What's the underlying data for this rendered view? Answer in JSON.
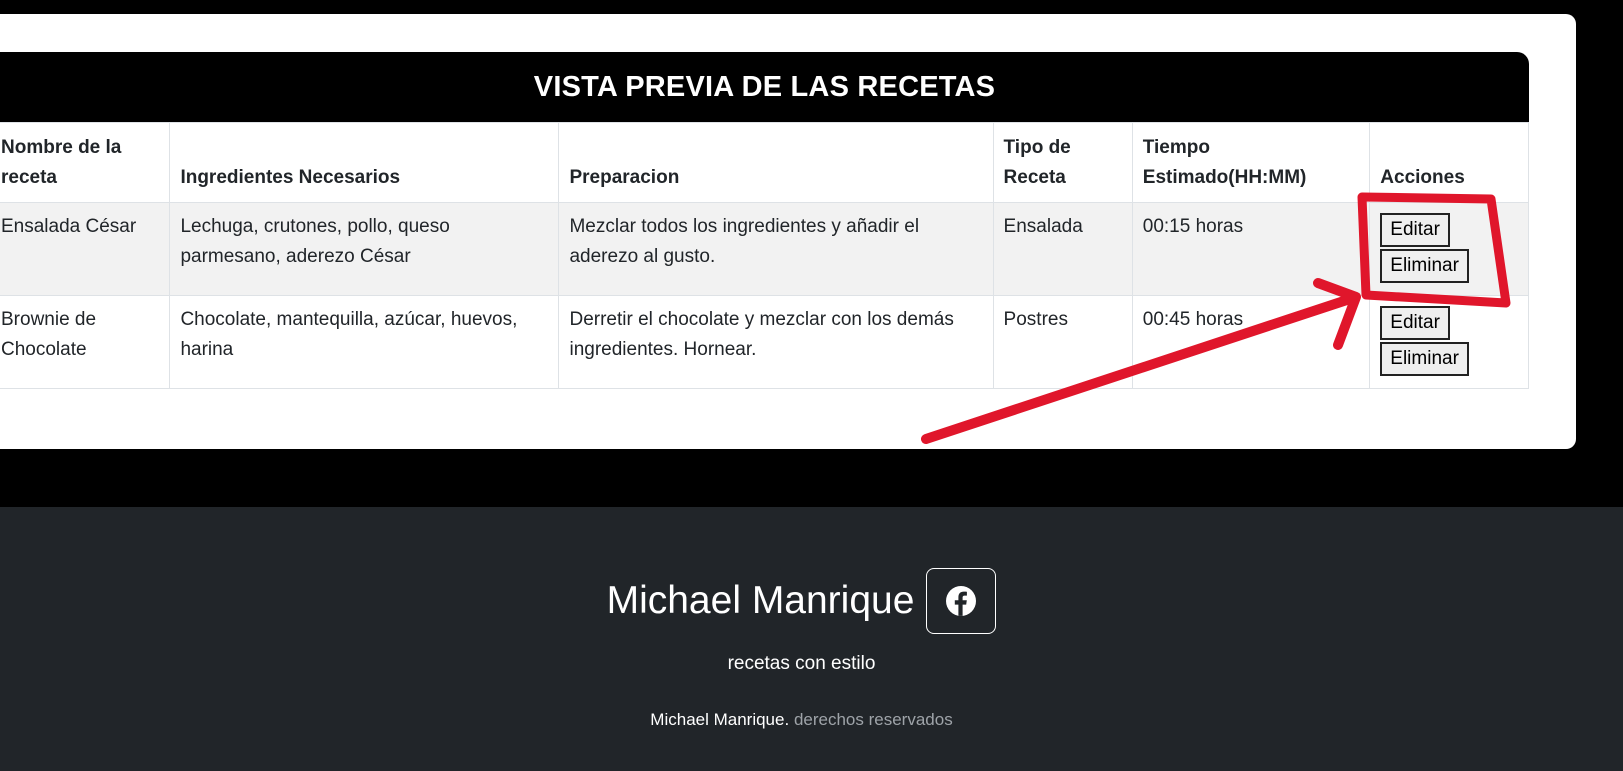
{
  "table": {
    "title": "VISTA PREVIA DE LAS RECETAS",
    "headers": {
      "name": "Nombre de la receta",
      "ingredients": "Ingredientes Necesarios",
      "preparation": "Preparacion",
      "type": "Tipo de Receta",
      "time": "Tiempo Estimado(HH:MM)",
      "actions": "Acciones"
    },
    "rows": [
      {
        "name": "Ensalada César",
        "ingredients": "Lechuga, crutones, pollo, queso parmesano, aderezo César",
        "preparation": "Mezclar todos los ingredientes y añadir el aderezo al gusto.",
        "type": "Ensalada",
        "time": "00:15 horas",
        "edit_label": "Editar",
        "delete_label": "Eliminar"
      },
      {
        "name": "Brownie de Chocolate",
        "ingredients": "Chocolate, mantequilla, azúcar, huevos, harina",
        "preparation": "Derretir el chocolate y mezclar con los demás ingredientes. Hornear.",
        "type": "Postres",
        "time": "00:45 horas",
        "edit_label": "Editar",
        "delete_label": "Eliminar"
      }
    ]
  },
  "footer": {
    "brand": "Michael Manrique",
    "social_icon": "facebook-icon",
    "tagline": "recetas con estilo",
    "copyright_name": "Michael Manrique.",
    "copyright_text": "derechos reservados"
  },
  "colors": {
    "page_bg": "#000000",
    "footer_bg": "#212529",
    "annotation_red": "#e0162b"
  }
}
